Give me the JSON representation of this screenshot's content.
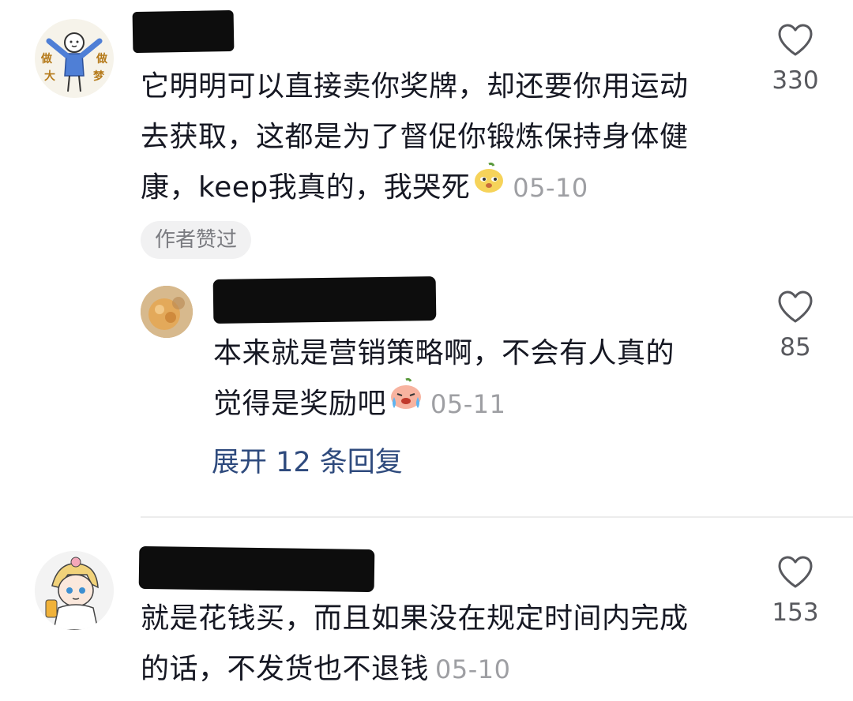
{
  "comments": [
    {
      "avatar_text": [
        "做",
        "做",
        "大",
        "梦"
      ],
      "lines": [
        "它明明可以直接卖你奖牌，却还要你用运动",
        "去获取，这都是为了督促你锻炼保持身体健",
        "康，keep我真的，我哭死"
      ],
      "date": "05-10",
      "likes": "330",
      "badge": "作者赞过"
    },
    {
      "lines": [
        "本来就是营销策略啊，不会有人真的",
        "觉得是奖励吧"
      ],
      "date": "05-11",
      "likes": "85",
      "expand": "展开 12 条回复"
    },
    {
      "lines": [
        "就是花钱买，而且如果没在规定时间内完成",
        "的话，不发货也不退钱"
      ],
      "date": "05-10",
      "likes": "153"
    }
  ],
  "icons": {
    "like": "heart-outline-icon",
    "emoji1": "smug-face-emoji-icon",
    "emoji2": "crying-face-emoji-icon"
  },
  "colors": {
    "text": "#161823",
    "date": "#9e9fa3",
    "expand_link": "#2e4a7d",
    "redaction": "#0d0d0d"
  }
}
